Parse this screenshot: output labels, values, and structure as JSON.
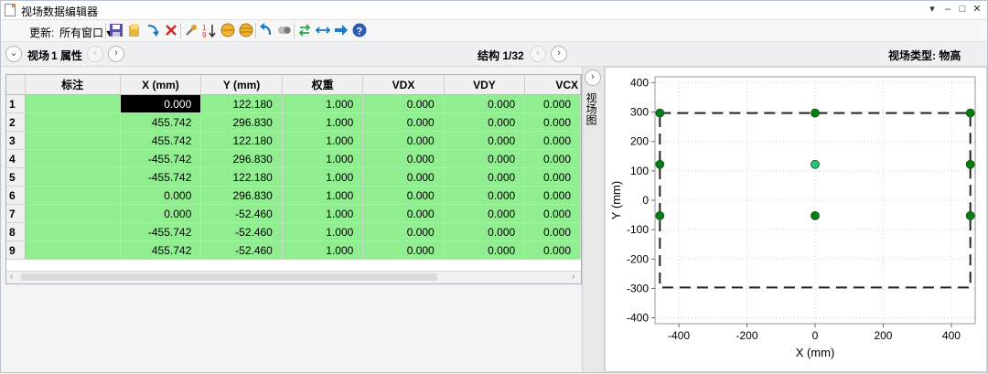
{
  "window": {
    "title": "视场数据编辑器"
  },
  "toolbar": {
    "update_label": "更新:",
    "update_value": "所有窗口"
  },
  "subbar": {
    "field_label": "视场",
    "attr_label": "1 属性",
    "structure_label": "结构 1/32",
    "field_type_label": "视场类型: 物高"
  },
  "table": {
    "columns": [
      "标注",
      "X (mm)",
      "Y (mm)",
      "权重",
      "VDX",
      "VDY",
      "VCX"
    ],
    "rows": [
      {
        "n": "1",
        "label": "",
        "x": "0.000",
        "y": "122.180",
        "w": "1.000",
        "vdx": "0.000",
        "vdy": "0.000",
        "vcx": "0.000"
      },
      {
        "n": "2",
        "label": "",
        "x": "455.742",
        "y": "296.830",
        "w": "1.000",
        "vdx": "0.000",
        "vdy": "0.000",
        "vcx": "0.000"
      },
      {
        "n": "3",
        "label": "",
        "x": "455.742",
        "y": "122.180",
        "w": "1.000",
        "vdx": "0.000",
        "vdy": "0.000",
        "vcx": "0.000"
      },
      {
        "n": "4",
        "label": "",
        "x": "-455.742",
        "y": "296.830",
        "w": "1.000",
        "vdx": "0.000",
        "vdy": "0.000",
        "vcx": "0.000"
      },
      {
        "n": "5",
        "label": "",
        "x": "-455.742",
        "y": "122.180",
        "w": "1.000",
        "vdx": "0.000",
        "vdy": "0.000",
        "vcx": "0.000"
      },
      {
        "n": "6",
        "label": "",
        "x": "0.000",
        "y": "296.830",
        "w": "1.000",
        "vdx": "0.000",
        "vdy": "0.000",
        "vcx": "0.000"
      },
      {
        "n": "7",
        "label": "",
        "x": "0.000",
        "y": "-52.460",
        "w": "1.000",
        "vdx": "0.000",
        "vdy": "0.000",
        "vcx": "0.000"
      },
      {
        "n": "8",
        "label": "",
        "x": "-455.742",
        "y": "-52.460",
        "w": "1.000",
        "vdx": "0.000",
        "vdy": "0.000",
        "vcx": "0.000"
      },
      {
        "n": "9",
        "label": "",
        "x": "455.742",
        "y": "-52.460",
        "w": "1.000",
        "vdx": "0.000",
        "vdy": "0.000",
        "vcx": "0.000"
      }
    ],
    "selected_row": 0,
    "row_color": "#90ee90"
  },
  "side_tab": {
    "label": "视场图"
  },
  "chart_data": {
    "type": "scatter",
    "title": "",
    "xlabel": "X (mm)",
    "ylabel": "Y (mm)",
    "xlim": [
      -470,
      470
    ],
    "ylim": [
      -420,
      420
    ],
    "xticks": [
      -400,
      -200,
      0,
      200,
      400
    ],
    "yticks": [
      -400,
      -300,
      -200,
      -100,
      0,
      100,
      200,
      300,
      400
    ],
    "grid": true,
    "points": [
      {
        "x": 0,
        "y": 122.18,
        "selected": true
      },
      {
        "x": 455.742,
        "y": 296.83
      },
      {
        "x": 455.742,
        "y": 122.18
      },
      {
        "x": -455.742,
        "y": 296.83
      },
      {
        "x": -455.742,
        "y": 122.18
      },
      {
        "x": 0,
        "y": 296.83
      },
      {
        "x": 0,
        "y": -52.46
      },
      {
        "x": -455.742,
        "y": -52.46
      },
      {
        "x": 455.742,
        "y": -52.46
      }
    ],
    "boundary": {
      "xmin": -455.742,
      "xmax": 455.742,
      "ymin": -296.83,
      "ymax": 296.83
    },
    "point_color": "#0a7a12",
    "selected_color": "#29c27a"
  }
}
